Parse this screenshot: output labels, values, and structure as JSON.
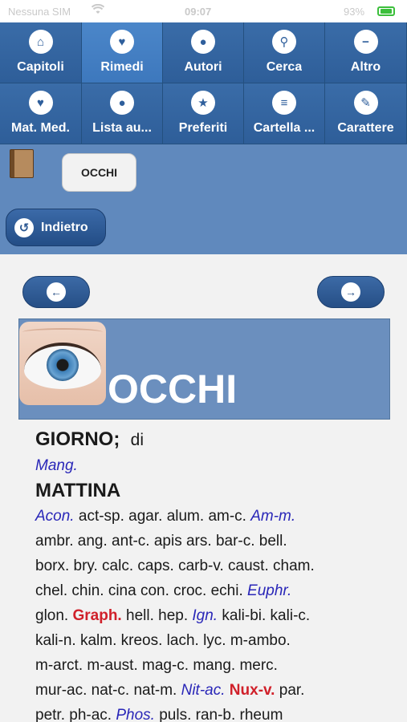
{
  "status_bar": {
    "carrier": "Nessuna SIM",
    "time": "09:07",
    "battery": "93%"
  },
  "menu": {
    "row1": [
      {
        "label": "Capitoli",
        "icon": "home-icon",
        "glyph": "⌂"
      },
      {
        "label": "Rimedi",
        "icon": "heart-icon",
        "glyph": "♥"
      },
      {
        "label": "Autori",
        "icon": "user-icon",
        "glyph": "●"
      },
      {
        "label": "Cerca",
        "icon": "search-icon",
        "glyph": "⚲"
      },
      {
        "label": "Altro",
        "icon": "minus-icon",
        "glyph": "−"
      }
    ],
    "row2": [
      {
        "label": "Mat. Med.",
        "icon": "heart-icon",
        "glyph": "♥"
      },
      {
        "label": "Lista au...",
        "icon": "user-icon",
        "glyph": "●"
      },
      {
        "label": "Preferiti",
        "icon": "star-icon",
        "glyph": "★"
      },
      {
        "label": "Cartella ...",
        "icon": "list-icon",
        "glyph": "≡"
      },
      {
        "label": "Carattere",
        "icon": "pencil-icon",
        "glyph": "✎"
      }
    ]
  },
  "toolbar": {
    "chip_label": "OCCHI",
    "back_label": "Indietro",
    "back_glyph": "↺"
  },
  "nav": {
    "prev_glyph": "←",
    "next_glyph": "→"
  },
  "banner": {
    "title": "OCCHI"
  },
  "content": {
    "heading1": "GIORNO;",
    "heading1_suffix": "di",
    "line_mang": "Mang.",
    "heading2": "MATTINA",
    "remedies": [
      [
        {
          "t": "Acon.",
          "s": "ib"
        },
        {
          "t": " act-sp. agar. alum. am-c. ",
          "s": "n"
        },
        {
          "t": "Am-m.",
          "s": "ib"
        }
      ],
      [
        {
          "t": "ambr. ang. ant-c. apis ars. bar-c. bell.",
          "s": "n"
        }
      ],
      [
        {
          "t": "borx. bry. calc. caps. carb-v. caust. cham.",
          "s": "n"
        }
      ],
      [
        {
          "t": "chel. chin. cina con. croc. echi. ",
          "s": "n"
        },
        {
          "t": "Euphr.",
          "s": "ib"
        }
      ],
      [
        {
          "t": "glon. ",
          "s": "n"
        },
        {
          "t": "Graph.",
          "s": "rb"
        },
        {
          "t": " hell. hep. ",
          "s": "n"
        },
        {
          "t": "Ign.",
          "s": "ib"
        },
        {
          "t": " kali-bi. kali-c.",
          "s": "n"
        }
      ],
      [
        {
          "t": "kali-n. kalm. kreos. lach. lyc. m-ambo.",
          "s": "n"
        }
      ],
      [
        {
          "t": "m-arct. m-aust. mag-c. mang. merc.",
          "s": "n"
        }
      ],
      [
        {
          "t": "mur-ac. nat-c. nat-m. ",
          "s": "n"
        },
        {
          "t": "Nit-ac.",
          "s": "ib"
        },
        {
          "t": " ",
          "s": "n"
        },
        {
          "t": "Nux-v.",
          "s": "rb"
        },
        {
          "t": " par.",
          "s": "n"
        }
      ],
      [
        {
          "t": "petr. ph-ac. ",
          "s": "n"
        },
        {
          "t": "Phos.",
          "s": "ib"
        },
        {
          "t": " puls. ran-b. rheum",
          "s": "n"
        }
      ]
    ]
  }
}
